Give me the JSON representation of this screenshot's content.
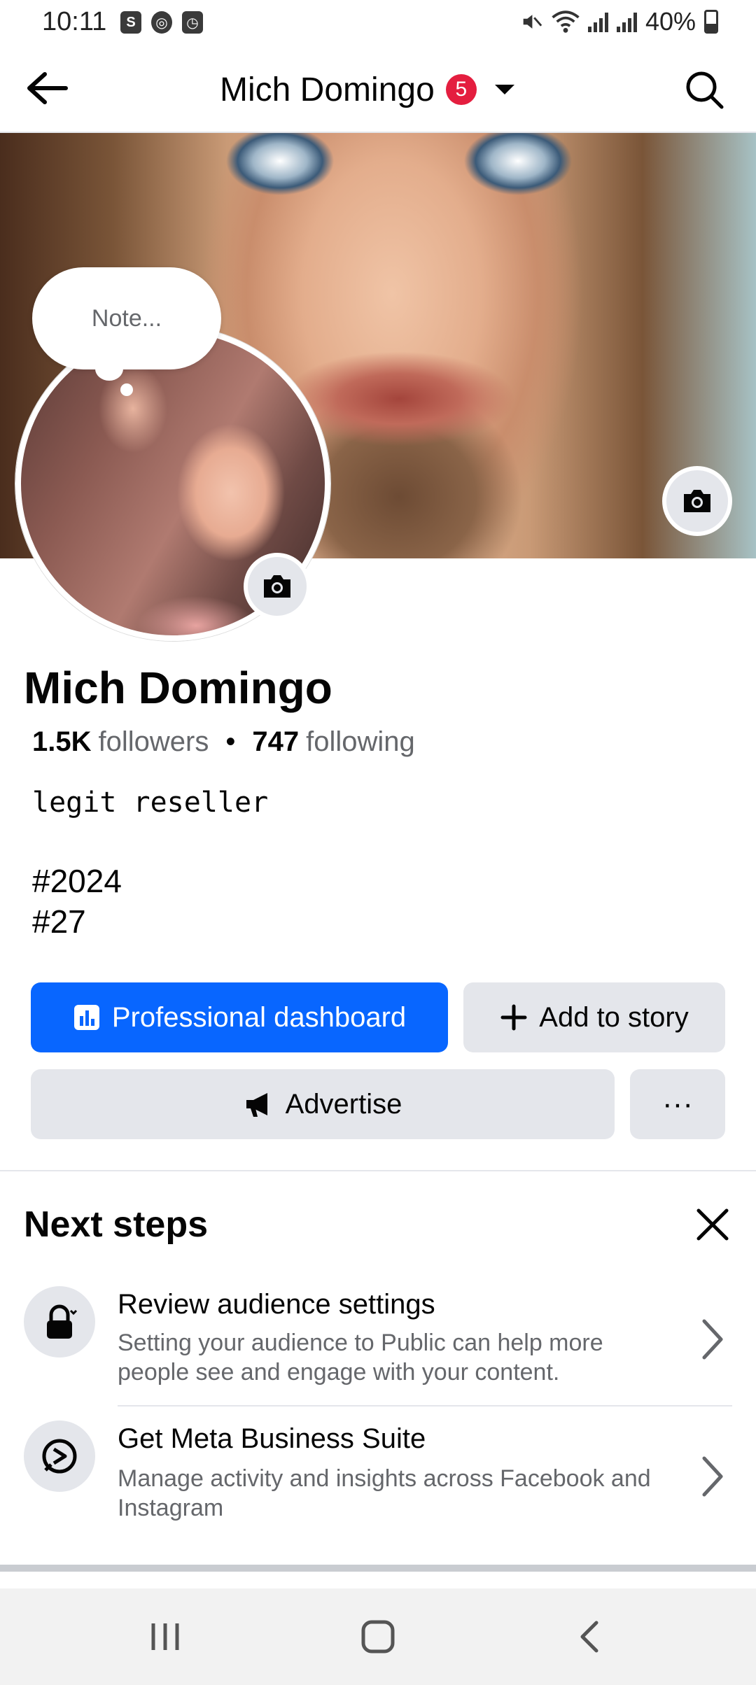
{
  "status_bar": {
    "time": "10:11",
    "left_icons": [
      "shopee-icon",
      "chrome-icon",
      "clock-app-icon"
    ],
    "battery": "40%",
    "battery_level": 0.4,
    "right_icons": [
      "mute-icon",
      "wifi-icon",
      "signal-icon",
      "signal-icon",
      "battery-icon"
    ]
  },
  "topbar": {
    "title": "Mich Domingo",
    "notification_count": "5"
  },
  "profile": {
    "note_placeholder": "Note...",
    "name": "Mich Domingo",
    "followers_count": "1.5K",
    "followers_label": "followers",
    "separator": "•",
    "following_count": "747",
    "following_label": "following",
    "bio": "legit reseller",
    "hashtags": [
      "#2024",
      "#27"
    ]
  },
  "actions": {
    "professional_dashboard": "Professional dashboard",
    "add_to_story": "Add to story",
    "advertise": "Advertise",
    "more": "···"
  },
  "next_steps": {
    "title": "Next steps",
    "items": [
      {
        "title": "Review audience settings",
        "description": "Setting your audience to Public can help more people see and engage with your content.",
        "icon": "lock-icon"
      },
      {
        "title": "Get Meta Business Suite",
        "description": "Manage activity and insights across Facebook and Instagram",
        "icon": "business-suite-icon"
      }
    ]
  },
  "colors": {
    "primary": "#0866ff",
    "badge": "#e41e3f",
    "secondary_bg": "#e4e6eb",
    "text": "#050505",
    "muted_text": "#65676b"
  }
}
